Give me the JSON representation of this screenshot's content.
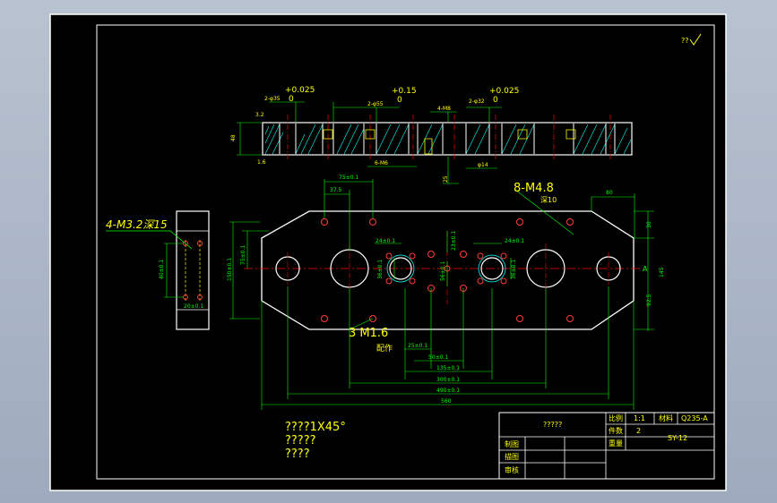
{
  "colors": {
    "background": "#000000",
    "frame": "#ffffff",
    "outline": "#ffffff",
    "dimension": "#00ff00",
    "hidden_line": "#ffff00",
    "center_line": "#ff0000",
    "hatch": "#00ffff",
    "label_yellow": "#ffff00",
    "thread_hole": "#ff3b3b"
  },
  "corner_mark": "??",
  "section_view": {
    "tol_left_plus": "+0.025",
    "tol_left_zero": "0",
    "tol_mid_plus": "+0.15",
    "tol_mid_zero": "0",
    "tol_right_plus": "+0.025",
    "tol_right_zero": "0",
    "label_2phi35": "2-φ35",
    "label_2phi55": "2-φ55",
    "label_4m8": "4-M8",
    "label_2phi32": "2-φ32",
    "label_6m6": "6-M6",
    "label_phi14": "φ14",
    "dim_height": "48",
    "dim_25": "25",
    "roughness_a": "3.2",
    "roughness_b": "1.6"
  },
  "plan_view": {
    "callout_left": "4-M3.2深15",
    "callout_8m": "8-M4.8",
    "callout_8m_sub": "深10",
    "callout_3m": "3 M1.6",
    "callout_peizuo": "配作",
    "dim_75": "75±0.1",
    "dim_375": "37.5",
    "dim_80": "80",
    "dim_30": "30",
    "dim_145": "145",
    "dim_925": "92.5",
    "dim_754": "75±0.1",
    "dim_150": "150±0.1",
    "dim_24a": "24±0.1",
    "dim_24b": "24±0.1",
    "dim_23": "23±0.1",
    "dim_36a": "36±0.1",
    "dim_36b": "36±0.1",
    "dim_56": "56±0.1",
    "dim_25": "25±0.1",
    "dim_50": "50±0.1",
    "dim_135": "135±0.1",
    "dim_300": "300±0.1",
    "dim_490": "490±0.1",
    "dim_560": "560",
    "section_mark": "A",
    "side_dim_40": "40±0.1",
    "side_dim_20": "20±0.1"
  },
  "notes": {
    "line1": "????1X45°",
    "line2": "?????",
    "line3": "????"
  },
  "title_block": {
    "part_name": "?????",
    "scale_label": "比例",
    "scale_value": "1:1",
    "material_label": "材料",
    "material_value": "Q235-A",
    "qty_label": "件数",
    "qty_value": "2",
    "drawing_no": "SY-12",
    "weight_label": "重量",
    "designer_label": "制图",
    "checker_label": "描图",
    "reviewer_label": "审核"
  }
}
